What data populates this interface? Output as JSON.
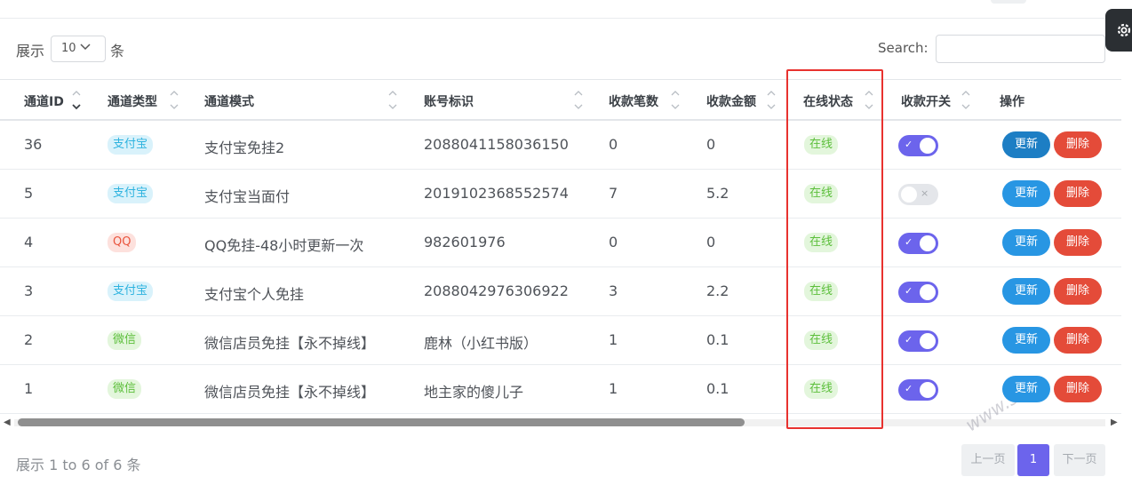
{
  "controls": {
    "length_label": "展示",
    "length_value": "10",
    "length_suffix": "条",
    "search_label": "Search:",
    "search_value": ""
  },
  "columns": [
    {
      "label": "通道ID",
      "sort": "desc"
    },
    {
      "label": "通道类型",
      "sort": "none"
    },
    {
      "label": "通道模式",
      "sort": "none"
    },
    {
      "label": "账号标识",
      "sort": "none"
    },
    {
      "label": "收款笔数",
      "sort": "none"
    },
    {
      "label": "收款金额",
      "sort": "none"
    },
    {
      "label": "在线状态",
      "sort": "none"
    },
    {
      "label": "收款开关",
      "sort": "none"
    },
    {
      "label": "操作"
    }
  ],
  "rows": [
    {
      "id": "36",
      "type": "支付宝",
      "type_color": "blue",
      "mode": "支付宝免挂2",
      "account": "2088041158036150",
      "count": "0",
      "amount": "0",
      "status": "在线",
      "switch": true
    },
    {
      "id": "5",
      "type": "支付宝",
      "type_color": "blue",
      "mode": "支付宝当面付",
      "account": "2019102368552574",
      "count": "7",
      "amount": "5.2",
      "status": "在线",
      "switch": false
    },
    {
      "id": "4",
      "type": "QQ",
      "type_color": "red",
      "mode": "QQ免挂-48小时更新一次",
      "account": "982601976",
      "count": "0",
      "amount": "0",
      "status": "在线",
      "switch": true
    },
    {
      "id": "3",
      "type": "支付宝",
      "type_color": "blue",
      "mode": "支付宝个人免挂",
      "account": "2088042976306922",
      "count": "3",
      "amount": "2.2",
      "status": "在线",
      "switch": true
    },
    {
      "id": "2",
      "type": "微信",
      "type_color": "green",
      "mode": "微信店员免挂【永不掉线】",
      "account": "鹿林（小红书版）",
      "count": "1",
      "amount": "0.1",
      "status": "在线",
      "switch": true
    },
    {
      "id": "1",
      "type": "微信",
      "type_color": "green",
      "mode": "微信店员免挂【永不掉线】",
      "account": "地主家的傻儿子",
      "count": "1",
      "amount": "0.1",
      "status": "在线",
      "switch": true
    }
  ],
  "actions": {
    "update": "更新",
    "delete": "删除"
  },
  "toggle_marks": {
    "on": "✓",
    "off": "×"
  },
  "footer": {
    "info": "展示 1 to 6 of 6 条",
    "prev": "上一页",
    "page": "1",
    "next": "下一页"
  },
  "watermark": "www.sanc",
  "colors": {
    "accent": "#6c64ec",
    "update": "#2896e3",
    "delete": "#e44b39",
    "highlight": "#e8322f"
  }
}
